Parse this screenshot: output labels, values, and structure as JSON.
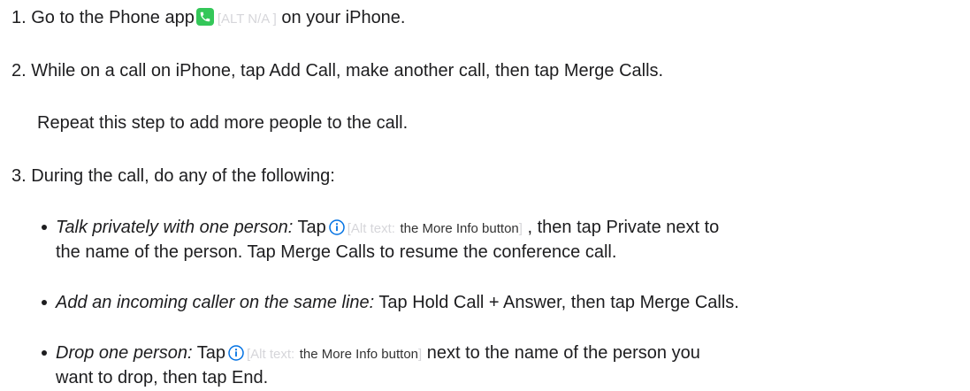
{
  "steps": [
    {
      "number": "1.",
      "text_before": "Go to the Phone app",
      "alt": "[ALT N/A ]",
      "text_after": "on your iPhone."
    },
    {
      "number": "2.",
      "text": "While on a call on iPhone, tap Add Call, make another call, then tap Merge Calls.",
      "note": "Repeat this step to add more people to the call."
    },
    {
      "number": "3.",
      "text": "During the call, do any of the following:",
      "bullets": [
        {
          "label": "Talk privately with one person:",
          "text_a": "Tap",
          "alt_prefix": "[Alt text:",
          "alt_value": "the More Info button",
          "alt_suffix": "]",
          "text_b": ", then tap Private next to",
          "line2": "the name of the person. Tap Merge Calls to resume the conference call."
        },
        {
          "label": "Add an incoming caller on the same line:",
          "text": "Tap Hold Call + Answer, then tap Merge Calls."
        },
        {
          "label": "Drop one person:",
          "text_a": "Tap",
          "alt_prefix": "[Alt text:",
          "alt_value": "the More Info button",
          "alt_suffix": "]",
          "text_b": "next to the name of the person you",
          "line2": "want to drop, then tap End."
        }
      ]
    }
  ],
  "icons": {
    "phone": "phone-app-icon",
    "info": "info-circle-icon"
  },
  "colors": {
    "text": "#1d1d1f",
    "phone_green": "#34c759",
    "info_blue": "#0071e3",
    "alt_faint": "#d6d6da"
  }
}
